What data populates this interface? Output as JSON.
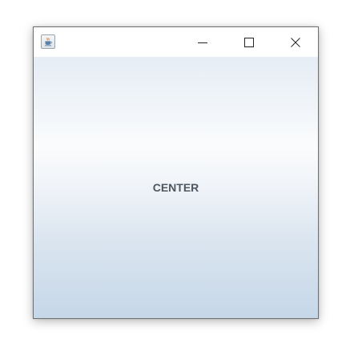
{
  "window": {
    "title": "",
    "controls": {
      "minimize_icon": "minimize-icon",
      "maximize_icon": "maximize-icon",
      "close_icon": "close-icon"
    },
    "app_icon": "java-cup-icon"
  },
  "content": {
    "center_label": "CENTER"
  },
  "colors": {
    "label": "#4e5660",
    "gradient_top": "#e6edf5",
    "gradient_mid": "#fbfcfd",
    "gradient_bottom": "#c6d7e8"
  }
}
